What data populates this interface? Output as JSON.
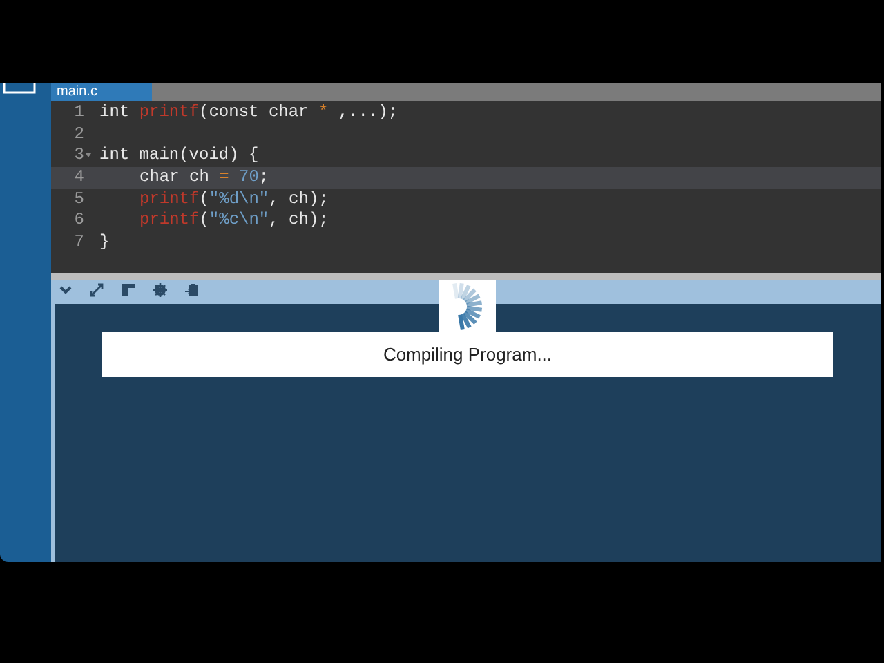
{
  "tab": {
    "label": "main.c",
    "selected": true
  },
  "editor": {
    "lines": [
      {
        "number": "1",
        "current": false,
        "foldable": false,
        "tokens": [
          {
            "text": "int ",
            "kind": "plain"
          },
          {
            "text": "printf",
            "kind": "function"
          },
          {
            "text": "(const char ",
            "kind": "plain"
          },
          {
            "text": "*",
            "kind": "operator"
          },
          {
            "text": " ,...);",
            "kind": "plain"
          }
        ]
      },
      {
        "number": "2",
        "current": false,
        "foldable": false
      },
      {
        "number": "3",
        "current": false,
        "foldable": true,
        "tokens": [
          {
            "text": "int main(void) {",
            "kind": "plain"
          }
        ]
      },
      {
        "number": "4",
        "current": true,
        "foldable": false,
        "indent": true,
        "tokens": [
          {
            "text": "char ch ",
            "kind": "plain"
          },
          {
            "text": "=",
            "kind": "operator"
          },
          {
            "text": " 70",
            "kind": "number"
          },
          {
            "text": ";",
            "kind": "plain"
          }
        ]
      },
      {
        "number": "5",
        "current": false,
        "foldable": false,
        "indent": true,
        "tokens": [
          {
            "text": "printf",
            "kind": "function"
          },
          {
            "text": "(",
            "kind": "plain"
          },
          {
            "text": "\"%d\\n\"",
            "kind": "string"
          },
          {
            "text": ", ch);",
            "kind": "plain"
          }
        ]
      },
      {
        "number": "6",
        "current": false,
        "foldable": false,
        "indent": true,
        "tokens": [
          {
            "text": "printf",
            "kind": "function"
          },
          {
            "text": "(",
            "kind": "plain"
          },
          {
            "text": "\"%c\\n\"",
            "kind": "string"
          },
          {
            "text": ", ch);",
            "kind": "plain"
          }
        ]
      },
      {
        "number": "7",
        "current": false,
        "foldable": false,
        "tokens": [
          {
            "text": "}",
            "kind": "plain"
          }
        ]
      }
    ]
  },
  "status": {
    "message": "Compiling Program..."
  }
}
